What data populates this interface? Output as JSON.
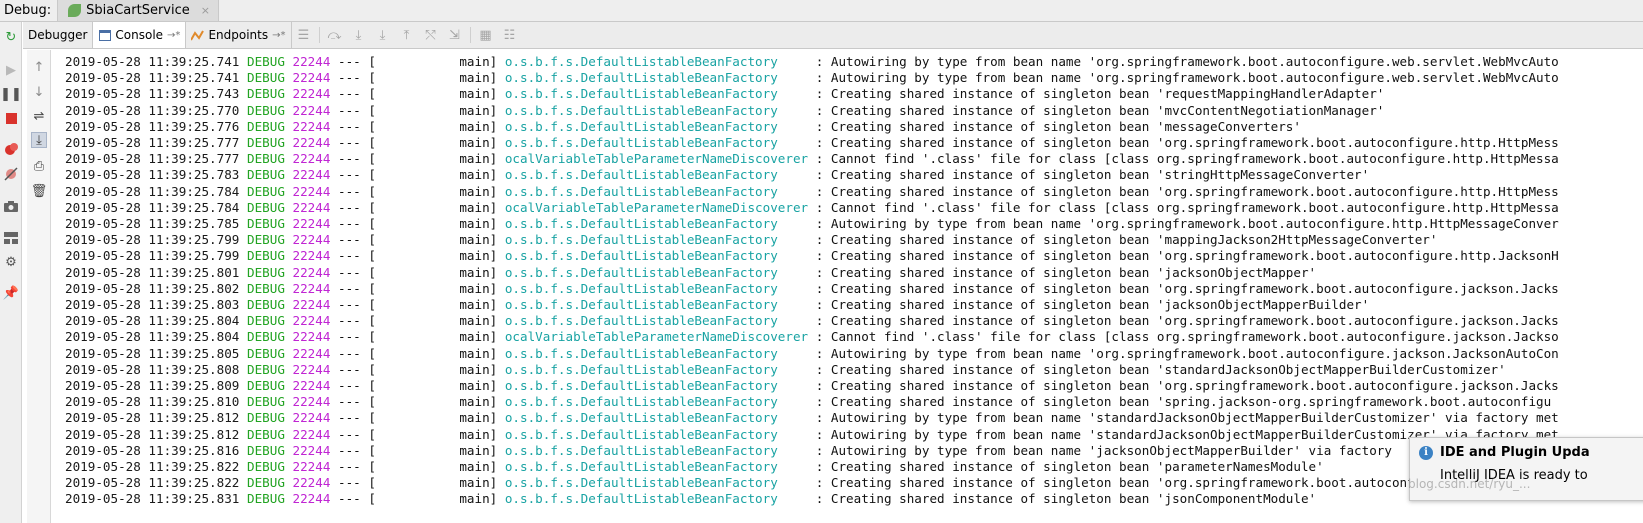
{
  "titlebar": {
    "label": "Debug:",
    "run_config": "SbiaCartService",
    "close_icon": "×"
  },
  "tabs": [
    {
      "label": "Debugger"
    },
    {
      "label": "Console",
      "pin": "→*"
    },
    {
      "label": "Endpoints",
      "pin": "→*"
    }
  ],
  "colors": {
    "level": "#22a322",
    "pid": "#c026d3",
    "logger": "#19a3a3",
    "info": "#3b82c4"
  },
  "icons": {
    "leftbar": [
      "rerun-icon",
      "resume-icon",
      "pause-icon",
      "stop-icon",
      "view-breakpoints-icon",
      "mute-breakpoints-icon",
      "camera-icon",
      "layout-icon",
      "settings-icon",
      "pin-icon"
    ],
    "sidebar2": [
      "up-arrow-icon",
      "down-arrow-icon",
      "soft-wrap-icon",
      "scroll-to-end-icon",
      "print-icon",
      "trash-icon"
    ],
    "toolbar": [
      "show-execution-point-icon",
      "step-over-icon",
      "step-into-icon",
      "force-step-into-icon",
      "step-out-icon",
      "drop-frame-icon",
      "run-to-cursor-icon",
      "evaluate-expression-icon",
      "trace-icon"
    ]
  },
  "log_lines": [
    {
      "ts": "2019-05-28 11:39:25.741",
      "level": "DEBUG",
      "pid": "22244",
      "thread": "--- [           main]",
      "logger": "o.s.b.f.s.DefaultListableBeanFactory    ",
      "msg": " : Autowiring by type from bean name 'org.springframework.boot.autoconfigure.web.servlet.WebMvcAuto"
    },
    {
      "ts": "2019-05-28 11:39:25.741",
      "level": "DEBUG",
      "pid": "22244",
      "thread": "--- [           main]",
      "logger": "o.s.b.f.s.DefaultListableBeanFactory    ",
      "msg": " : Autowiring by type from bean name 'org.springframework.boot.autoconfigure.web.servlet.WebMvcAuto"
    },
    {
      "ts": "2019-05-28 11:39:25.743",
      "level": "DEBUG",
      "pid": "22244",
      "thread": "--- [           main]",
      "logger": "o.s.b.f.s.DefaultListableBeanFactory    ",
      "msg": " : Creating shared instance of singleton bean 'requestMappingHandlerAdapter'"
    },
    {
      "ts": "2019-05-28 11:39:25.770",
      "level": "DEBUG",
      "pid": "22244",
      "thread": "--- [           main]",
      "logger": "o.s.b.f.s.DefaultListableBeanFactory    ",
      "msg": " : Creating shared instance of singleton bean 'mvcContentNegotiationManager'"
    },
    {
      "ts": "2019-05-28 11:39:25.776",
      "level": "DEBUG",
      "pid": "22244",
      "thread": "--- [           main]",
      "logger": "o.s.b.f.s.DefaultListableBeanFactory    ",
      "msg": " : Creating shared instance of singleton bean 'messageConverters'"
    },
    {
      "ts": "2019-05-28 11:39:25.777",
      "level": "DEBUG",
      "pid": "22244",
      "thread": "--- [           main]",
      "logger": "o.s.b.f.s.DefaultListableBeanFactory    ",
      "msg": " : Creating shared instance of singleton bean 'org.springframework.boot.autoconfigure.http.HttpMess"
    },
    {
      "ts": "2019-05-28 11:39:25.777",
      "level": "DEBUG",
      "pid": "22244",
      "thread": "--- [           main]",
      "logger": "ocalVariableTableParameterNameDiscoverer",
      "msg": " : Cannot find '.class' file for class [class org.springframework.boot.autoconfigure.http.HttpMessa"
    },
    {
      "ts": "2019-05-28 11:39:25.783",
      "level": "DEBUG",
      "pid": "22244",
      "thread": "--- [           main]",
      "logger": "o.s.b.f.s.DefaultListableBeanFactory    ",
      "msg": " : Creating shared instance of singleton bean 'stringHttpMessageConverter'"
    },
    {
      "ts": "2019-05-28 11:39:25.784",
      "level": "DEBUG",
      "pid": "22244",
      "thread": "--- [           main]",
      "logger": "o.s.b.f.s.DefaultListableBeanFactory    ",
      "msg": " : Creating shared instance of singleton bean 'org.springframework.boot.autoconfigure.http.HttpMess"
    },
    {
      "ts": "2019-05-28 11:39:25.784",
      "level": "DEBUG",
      "pid": "22244",
      "thread": "--- [           main]",
      "logger": "ocalVariableTableParameterNameDiscoverer",
      "msg": " : Cannot find '.class' file for class [class org.springframework.boot.autoconfigure.http.HttpMessa"
    },
    {
      "ts": "2019-05-28 11:39:25.785",
      "level": "DEBUG",
      "pid": "22244",
      "thread": "--- [           main]",
      "logger": "o.s.b.f.s.DefaultListableBeanFactory    ",
      "msg": " : Autowiring by type from bean name 'org.springframework.boot.autoconfigure.http.HttpMessageConver"
    },
    {
      "ts": "2019-05-28 11:39:25.799",
      "level": "DEBUG",
      "pid": "22244",
      "thread": "--- [           main]",
      "logger": "o.s.b.f.s.DefaultListableBeanFactory    ",
      "msg": " : Creating shared instance of singleton bean 'mappingJackson2HttpMessageConverter'"
    },
    {
      "ts": "2019-05-28 11:39:25.799",
      "level": "DEBUG",
      "pid": "22244",
      "thread": "--- [           main]",
      "logger": "o.s.b.f.s.DefaultListableBeanFactory    ",
      "msg": " : Creating shared instance of singleton bean 'org.springframework.boot.autoconfigure.http.JacksonH"
    },
    {
      "ts": "2019-05-28 11:39:25.801",
      "level": "DEBUG",
      "pid": "22244",
      "thread": "--- [           main]",
      "logger": "o.s.b.f.s.DefaultListableBeanFactory    ",
      "msg": " : Creating shared instance of singleton bean 'jacksonObjectMapper'"
    },
    {
      "ts": "2019-05-28 11:39:25.802",
      "level": "DEBUG",
      "pid": "22244",
      "thread": "--- [           main]",
      "logger": "o.s.b.f.s.DefaultListableBeanFactory    ",
      "msg": " : Creating shared instance of singleton bean 'org.springframework.boot.autoconfigure.jackson.Jacks"
    },
    {
      "ts": "2019-05-28 11:39:25.803",
      "level": "DEBUG",
      "pid": "22244",
      "thread": "--- [           main]",
      "logger": "o.s.b.f.s.DefaultListableBeanFactory    ",
      "msg": " : Creating shared instance of singleton bean 'jacksonObjectMapperBuilder'"
    },
    {
      "ts": "2019-05-28 11:39:25.804",
      "level": "DEBUG",
      "pid": "22244",
      "thread": "--- [           main]",
      "logger": "o.s.b.f.s.DefaultListableBeanFactory    ",
      "msg": " : Creating shared instance of singleton bean 'org.springframework.boot.autoconfigure.jackson.Jacks"
    },
    {
      "ts": "2019-05-28 11:39:25.804",
      "level": "DEBUG",
      "pid": "22244",
      "thread": "--- [           main]",
      "logger": "ocalVariableTableParameterNameDiscoverer",
      "msg": " : Cannot find '.class' file for class [class org.springframework.boot.autoconfigure.jackson.Jackso"
    },
    {
      "ts": "2019-05-28 11:39:25.805",
      "level": "DEBUG",
      "pid": "22244",
      "thread": "--- [           main]",
      "logger": "o.s.b.f.s.DefaultListableBeanFactory    ",
      "msg": " : Autowiring by type from bean name 'org.springframework.boot.autoconfigure.jackson.JacksonAutoCon"
    },
    {
      "ts": "2019-05-28 11:39:25.808",
      "level": "DEBUG",
      "pid": "22244",
      "thread": "--- [           main]",
      "logger": "o.s.b.f.s.DefaultListableBeanFactory    ",
      "msg": " : Creating shared instance of singleton bean 'standardJacksonObjectMapperBuilderCustomizer'"
    },
    {
      "ts": "2019-05-28 11:39:25.809",
      "level": "DEBUG",
      "pid": "22244",
      "thread": "--- [           main]",
      "logger": "o.s.b.f.s.DefaultListableBeanFactory    ",
      "msg": " : Creating shared instance of singleton bean 'org.springframework.boot.autoconfigure.jackson.Jacks"
    },
    {
      "ts": "2019-05-28 11:39:25.810",
      "level": "DEBUG",
      "pid": "22244",
      "thread": "--- [           main]",
      "logger": "o.s.b.f.s.DefaultListableBeanFactory    ",
      "msg": " : Creating shared instance of singleton bean 'spring.jackson-org.springframework.boot.autoconfigu"
    },
    {
      "ts": "2019-05-28 11:39:25.812",
      "level": "DEBUG",
      "pid": "22244",
      "thread": "--- [           main]",
      "logger": "o.s.b.f.s.DefaultListableBeanFactory    ",
      "msg": " : Autowiring by type from bean name 'standardJacksonObjectMapperBuilderCustomizer' via factory met"
    },
    {
      "ts": "2019-05-28 11:39:25.812",
      "level": "DEBUG",
      "pid": "22244",
      "thread": "--- [           main]",
      "logger": "o.s.b.f.s.DefaultListableBeanFactory    ",
      "msg": " : Autowiring by type from bean name 'standardJacksonObjectMapperBuilderCustomizer' via factory met"
    },
    {
      "ts": "2019-05-28 11:39:25.816",
      "level": "DEBUG",
      "pid": "22244",
      "thread": "--- [           main]",
      "logger": "o.s.b.f.s.DefaultListableBeanFactory    ",
      "msg": " : Autowiring by type from bean name 'jacksonObjectMapperBuilder' via factory"
    },
    {
      "ts": "2019-05-28 11:39:25.822",
      "level": "DEBUG",
      "pid": "22244",
      "thread": "--- [           main]",
      "logger": "o.s.b.f.s.DefaultListableBeanFactory    ",
      "msg": " : Creating shared instance of singleton bean 'parameterNamesModule'"
    },
    {
      "ts": "2019-05-28 11:39:25.822",
      "level": "DEBUG",
      "pid": "22244",
      "thread": "--- [           main]",
      "logger": "o.s.b.f.s.DefaultListableBeanFactory    ",
      "msg": " : Creating shared instance of singleton bean 'org.springframework.boot.autoconfigure.jackson.Jacks"
    },
    {
      "ts": "2019-05-28 11:39:25.831",
      "level": "DEBUG",
      "pid": "22244",
      "thread": "--- [           main]",
      "logger": "o.s.b.f.s.DefaultListableBeanFactory    ",
      "msg": " : Creating shared instance of singleton bean 'jsonComponentModule'"
    }
  ],
  "notification": {
    "title": "IDE and Plugin Upda",
    "body": "IntelliJ IDEA is ready to"
  },
  "watermark": "blog.csdn.net/ryu_..."
}
